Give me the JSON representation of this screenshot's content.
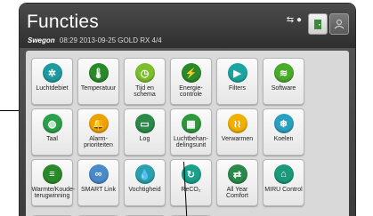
{
  "header": {
    "title": "Functies",
    "brand": "Swegon",
    "info": "08:29 2013-09-25 GOLD RX 4/4",
    "status_icons": "⇆ ●"
  },
  "tiles": [
    {
      "label": "Luchtdebiet",
      "icon": "fan-icon",
      "color": "#1e9a9e",
      "glyph": "✲"
    },
    {
      "label": "Temperatuur",
      "icon": "thermometer-icon",
      "color": "#2a8a2a",
      "glyph": "🌡"
    },
    {
      "label": "Tijd en schema",
      "icon": "clock-icon",
      "color": "#7bbf2a",
      "glyph": "◷"
    },
    {
      "label": "Energie-controle",
      "icon": "energy-icon",
      "color": "#2a8a2a",
      "glyph": "⚡"
    },
    {
      "label": "Filters",
      "icon": "filter-icon",
      "color": "#1aa5a0",
      "glyph": "▶"
    },
    {
      "label": "Software",
      "icon": "software-icon",
      "color": "#4aaa2a",
      "glyph": "≋"
    },
    {
      "label": "",
      "icon": "",
      "color": "",
      "glyph": ""
    },
    {
      "label": "Taal",
      "icon": "globe-icon",
      "color": "#2aa04a",
      "glyph": "◍"
    },
    {
      "label": "Alarm-prioriteiten",
      "icon": "bell-icon",
      "color": "#f0a000",
      "glyph": "🔔"
    },
    {
      "label": "Log",
      "icon": "log-icon",
      "color": "#2a8a4a",
      "glyph": "▭"
    },
    {
      "label": "Luchtbehan-delingsunit",
      "icon": "unit-icon",
      "color": "#2a9a3a",
      "glyph": "▦"
    },
    {
      "label": "Verwarmen",
      "icon": "heating-icon",
      "color": "#f0b000",
      "glyph": "≀≀"
    },
    {
      "label": "Koelen",
      "icon": "snowflake-icon",
      "color": "#2aa0c0",
      "glyph": "❄"
    },
    {
      "label": "",
      "icon": "",
      "color": "",
      "glyph": ""
    },
    {
      "label": "Warmte/Koude-terugwinning",
      "icon": "recovery-icon",
      "color": "#2a8a2a",
      "glyph": "≡"
    },
    {
      "label": "SMART Link",
      "icon": "link-icon",
      "color": "#4a8ac8",
      "glyph": "∞"
    },
    {
      "label": "Vochtigheid",
      "icon": "humidity-icon",
      "color": "#2aa0b0",
      "glyph": "💧"
    },
    {
      "label": "ReCO₂",
      "icon": "reco2-icon",
      "color": "#1aa08a",
      "glyph": "↻"
    },
    {
      "label": "All Year Comfort",
      "icon": "comfort-icon",
      "color": "#2a8a4a",
      "glyph": "⇄"
    },
    {
      "label": "MIRU Control",
      "icon": "home-icon",
      "color": "#1a9a7a",
      "glyph": "⌂"
    }
  ]
}
